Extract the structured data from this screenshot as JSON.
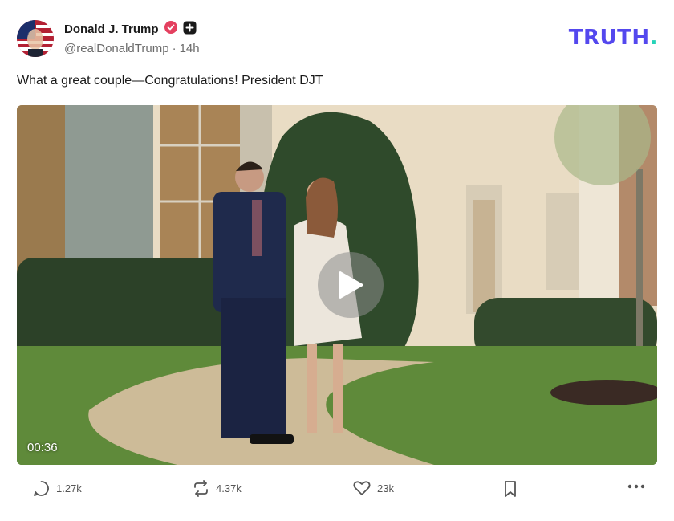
{
  "author": {
    "name": "Donald J. Trump",
    "handle": "@realDonaldTrump",
    "separator": "·",
    "time": "14h",
    "avatar_icon": "flag-portrait-avatar",
    "verified_icon": "verified-badge-icon",
    "verified_color": "#e4405f",
    "plus_icon": "plus-badge-icon"
  },
  "brand": {
    "logo_text": "TRUTH",
    "logo_dot": ".",
    "logo_color": "#5448ee",
    "dot_color": "#25d3b8"
  },
  "post": {
    "text": "What a great couple—Congratulations! President DJT"
  },
  "video": {
    "duration": "00:36",
    "play_icon": "play-icon"
  },
  "actions": {
    "reply": {
      "icon": "reply-icon",
      "count": "1.27k"
    },
    "retruth": {
      "icon": "retruth-icon",
      "count": "4.37k"
    },
    "like": {
      "icon": "heart-icon",
      "count": "23k"
    },
    "bookmark": {
      "icon": "bookmark-icon"
    },
    "more": {
      "icon": "more-icon"
    }
  }
}
